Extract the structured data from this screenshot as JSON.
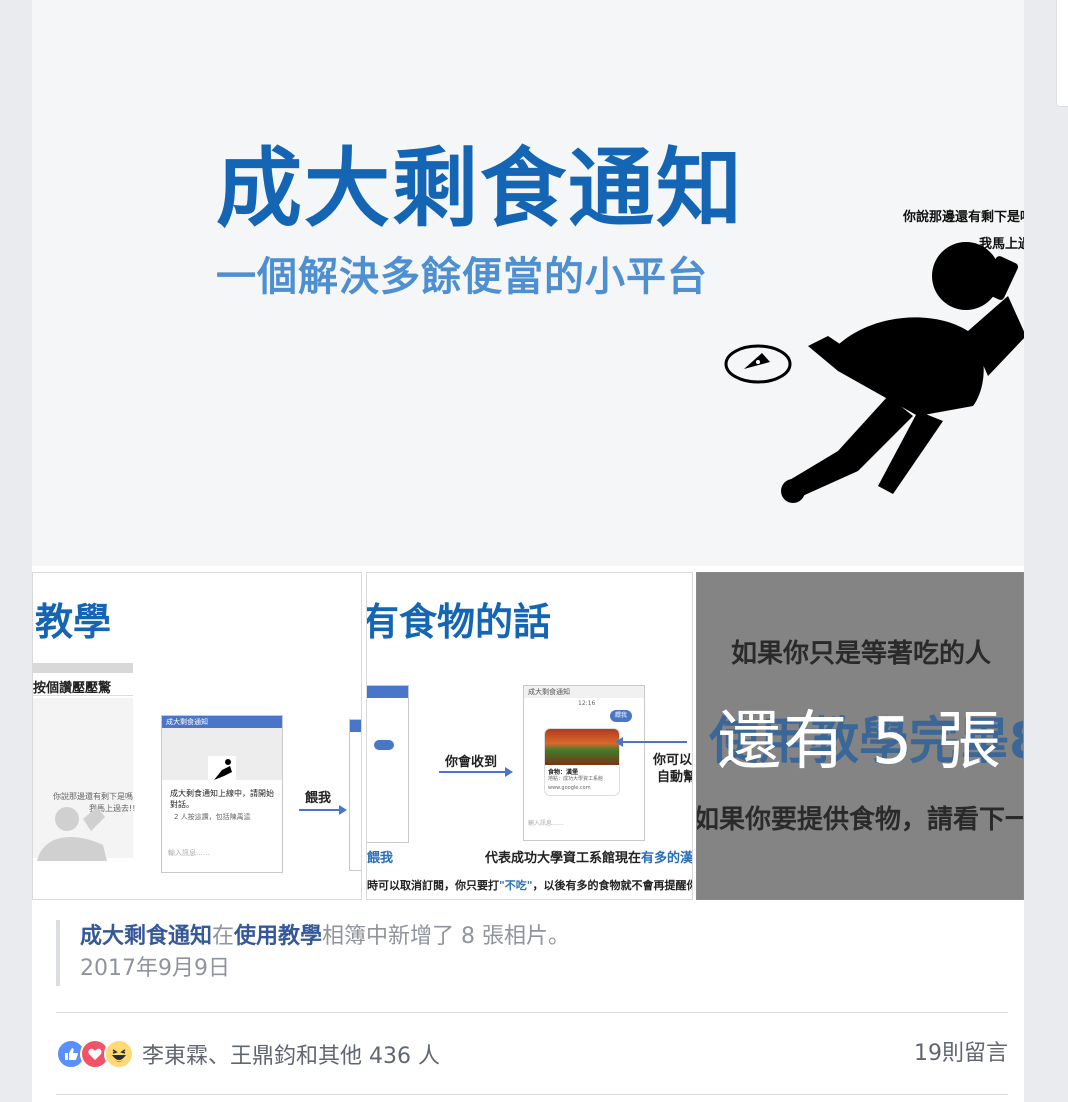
{
  "hero": {
    "title": "成大剩食通知",
    "subtitle": "一個解決多餘便當的小平台",
    "speech_line1": "你說那邊還有剩下是嗎",
    "speech_line2": "我馬上過",
    "colors": {
      "title": "#1565b5",
      "subtitle": "#4d8fd0",
      "background": "#f5f6f7"
    }
  },
  "thumbnails": [
    {
      "heading": "教學",
      "subheading": "按個讚壓壓驚",
      "window_title": "成大剩食通知",
      "status_text": "成大剩食通知上線中，請開始對話。",
      "people_text": "2 人按這讚，包括陳禹逵",
      "chat_line1": "你說那邊還有剩下是嗎",
      "chat_line2": "我馬上過去!!",
      "send_label": "餵我",
      "input_placeholder": "輸入訊息……"
    },
    {
      "heading": "有食物的話",
      "receive_label": "你會收到",
      "auto_label1": "你可以聽",
      "auto_label2": "自動幫",
      "window_title": "成大剩食通知",
      "time": "12:16",
      "reply_chip": "餵我",
      "food_name": "食物：漢堡",
      "food_location": "地點：成功大學資工系館",
      "food_link": "www.google.com",
      "left_label": "餵我",
      "caption_prefix": "代表成功大學資工系館現在",
      "caption_highlight": "有多的漢堡",
      "bottom_note_prefix": "時可以取消訂閱，你只要打",
      "bottom_note_quote": "\"不吃\"",
      "bottom_note_suffix": "，以後有多的食物就不會再提醒你",
      "input_placeholder": "輸入訊息……"
    },
    {
      "line1": "如果你只是等著吃的人",
      "line2_partial": "使用教學完畢8",
      "line3": "如果你要提供食物，請看下一",
      "more_overlay": "還有 5 張"
    }
  ],
  "caption": {
    "page_name": "成大剩食通知",
    "text_in": "在",
    "album_name": "使用教學",
    "text_rest": "相簿中新增了 8 張相片。",
    "date": "2017年9月9日"
  },
  "reactions": {
    "icons": [
      "like-icon",
      "love-icon",
      "haha-icon"
    ],
    "names_text": "李東霖、王鼎鈞和其他 436 人",
    "colors": {
      "like": "#5890ff",
      "love": "#f25268",
      "haha": "#ffd972"
    }
  },
  "comments": {
    "count_text": "19則留言"
  }
}
